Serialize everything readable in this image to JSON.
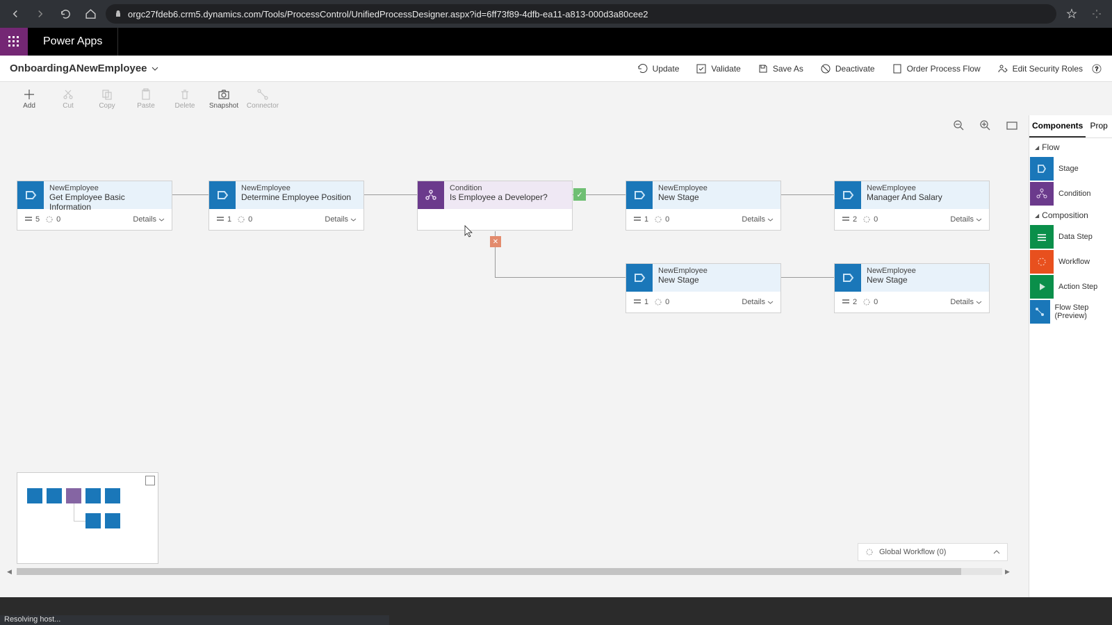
{
  "browser": {
    "url": "orgc27fdeb6.crm5.dynamics.com/Tools/ProcessControl/UnifiedProcessDesigner.aspx?id=6ff73f89-4dfb-ea11-a813-000d3a80cee2"
  },
  "app_name": "Power Apps",
  "process_name": "OnboardingANewEmployee",
  "commands": {
    "update": "Update",
    "validate": "Validate",
    "save_as": "Save As",
    "deactivate": "Deactivate",
    "order": "Order Process Flow",
    "edit_roles": "Edit Security Roles"
  },
  "toolbar": {
    "add": "Add",
    "cut": "Cut",
    "copy": "Copy",
    "paste": "Paste",
    "delete": "Delete",
    "snapshot": "Snapshot",
    "connector": "Connector"
  },
  "panel": {
    "tab_components": "Components",
    "tab_properties": "Prop",
    "section_flow": "Flow",
    "section_composition": "Composition",
    "items": {
      "stage": "Stage",
      "condition": "Condition",
      "data_step": "Data Step",
      "workflow": "Workflow",
      "action_step": "Action Step",
      "flow_step": "Flow Step (Preview)"
    }
  },
  "nodes": {
    "s1": {
      "entity": "NewEmployee",
      "name": "Get Employee Basic Information",
      "steps": "5",
      "wf": "0",
      "details": "Details"
    },
    "s2": {
      "entity": "NewEmployee",
      "name": "Determine Employee Position",
      "steps": "1",
      "wf": "0",
      "details": "Details"
    },
    "c1": {
      "entity": "Condition",
      "name": "Is Employee a Developer?"
    },
    "s3": {
      "entity": "NewEmployee",
      "name": "New Stage",
      "steps": "1",
      "wf": "0",
      "details": "Details"
    },
    "s4": {
      "entity": "NewEmployee",
      "name": "Manager And Salary",
      "steps": "2",
      "wf": "0",
      "details": "Details"
    },
    "s5": {
      "entity": "NewEmployee",
      "name": "New Stage",
      "steps": "1",
      "wf": "0",
      "details": "Details"
    },
    "s6": {
      "entity": "NewEmployee",
      "name": "New Stage",
      "steps": "2",
      "wf": "0",
      "details": "Details"
    }
  },
  "global_workflow": "Global Workflow (0)",
  "status": "Resolving host..."
}
